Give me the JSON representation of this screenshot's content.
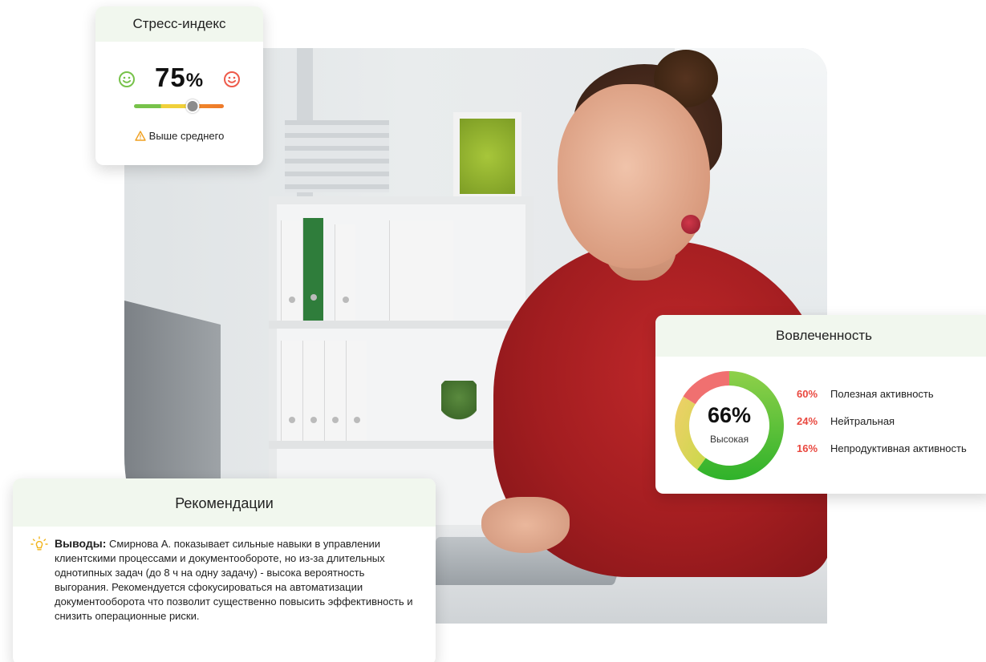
{
  "stress": {
    "title": "Стресс-индекс",
    "value": "75",
    "unit": "%",
    "level": 0.65,
    "status": "Выше среднего",
    "icons": [
      "smile-green-icon",
      "smile-red-icon",
      "warning-icon"
    ],
    "colors": {
      "good": "#77c24a",
      "mid": "#f0d03a",
      "bad": "#ee5a4a"
    }
  },
  "engagement": {
    "title": "Вовлеченность",
    "value": "66%",
    "label": "Высокая",
    "items": [
      {
        "percent": "60%",
        "label": "Полезная активность",
        "value": 60
      },
      {
        "percent": "24%",
        "label": "Нейтральная",
        "value": 24
      },
      {
        "percent": "16%",
        "label": "Непродуктивная активность",
        "value": 16
      }
    ],
    "colors": {
      "useful": "#3cb52b",
      "neutral": "#e9d35a",
      "unproductive": "#f07070"
    }
  },
  "recommendations": {
    "title": "Рекомендации",
    "lead": "Выводы:",
    "text": "Смирнова А. показывает сильные навыки в управлении клиентскими процессами и документообороте, но из-за длительных однотипных задач (до 8 ч на одну задачу) - высока вероятность выгорания. Рекомендуется сфокусироваться на автоматизации документооборота что позволит существенно повысить эффективность и снизить операционные риски.",
    "icon": "lightbulb-icon"
  }
}
